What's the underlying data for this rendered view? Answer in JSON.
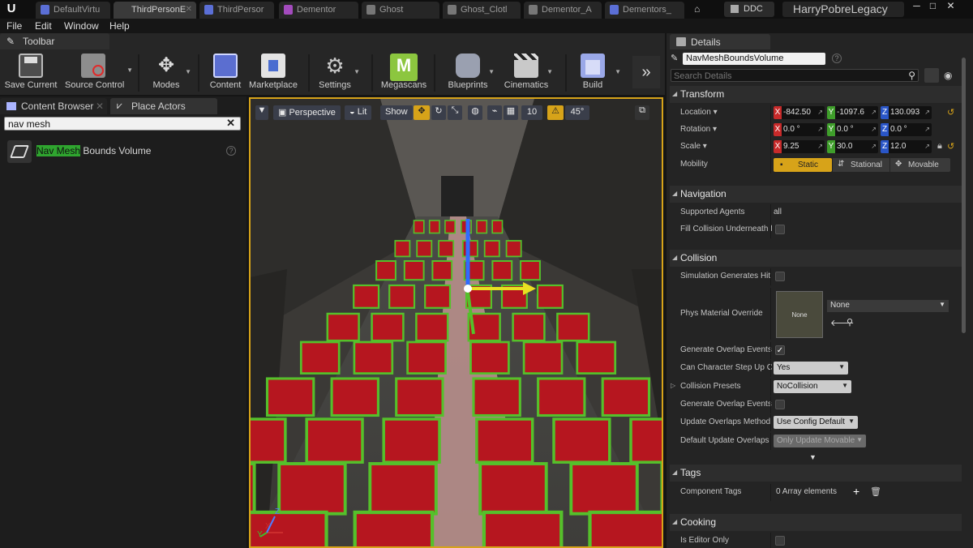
{
  "title_bar": {
    "tabs": [
      {
        "label": "DefaultVirtu",
        "color": "#5b6fd6"
      },
      {
        "label": "ThirdPersonE",
        "color": "#5b6fd6"
      },
      {
        "label": "ThirdPersor",
        "color": "#5b6fd6"
      },
      {
        "label": "Dementor",
        "color": "#a34bbd"
      },
      {
        "label": "Ghost",
        "color": "#9a9a9a"
      },
      {
        "label": "Ghost_Clotl",
        "color": "#9a9a9a"
      },
      {
        "label": "Dementor_A",
        "color": "#9a9a9a"
      },
      {
        "label": "Dementors_",
        "color": "#5b6fd6"
      }
    ],
    "ddc_label": "DDC",
    "project_name": "HarryPobreLegacy",
    "window_buttons": [
      "─",
      "□",
      "✕"
    ]
  },
  "menu": [
    "File",
    "Edit",
    "Window",
    "Help"
  ],
  "toolbar": {
    "tab_label": "Toolbar",
    "buttons": [
      {
        "label": "Save Current",
        "icon": "save-icon"
      },
      {
        "label": "Source Control",
        "icon": "source-control-icon"
      },
      {
        "label": "Modes",
        "icon": "modes-icon"
      },
      {
        "label": "Content",
        "icon": "content-icon"
      },
      {
        "label": "Marketplace",
        "icon": "marketplace-icon"
      },
      {
        "label": "Settings",
        "icon": "settings-icon"
      },
      {
        "label": "Megascans",
        "icon": "megascans-icon",
        "glyph": "M"
      },
      {
        "label": "Blueprints",
        "icon": "blueprints-icon"
      },
      {
        "label": "Cinematics",
        "icon": "cinematics-icon"
      },
      {
        "label": "Build",
        "icon": "build-icon"
      }
    ],
    "more": "»"
  },
  "left_panel": {
    "tabs": [
      "Content Browser",
      "Place Actors"
    ],
    "search_value": "nav mesh",
    "result": {
      "highlight": "Nav Mesh",
      "rest": " Bounds Volume"
    }
  },
  "viewport": {
    "buttons": [
      "Perspective",
      "Lit",
      "Show"
    ],
    "grid_value": "10",
    "angle_value": "45°",
    "axis": {
      "x": "X",
      "y": "Y",
      "z": "Z"
    }
  },
  "details": {
    "tab_label": "Details",
    "actor_name": "NavMeshBoundsVolume",
    "search_placeholder": "Search Details",
    "sections": {
      "transform": "Transform",
      "navigation": "Navigation",
      "collision": "Collision",
      "tags": "Tags",
      "cooking": "Cooking"
    },
    "location": {
      "label": "Location",
      "x": "-842.50",
      "y": "-1097.6",
      "z": "130.093"
    },
    "rotation": {
      "label": "Rotation",
      "x": "0.0 °",
      "y": "0.0 °",
      "z": "0.0 °"
    },
    "scale": {
      "label": "Scale",
      "x": "9.25",
      "y": "30.0",
      "z": "12.0"
    },
    "mobility": {
      "label": "Mobility",
      "options": [
        "Static",
        "Stational",
        "Movable"
      ],
      "selected": "Static"
    },
    "supported_agents": {
      "label": "Supported Agents",
      "value": "all"
    },
    "fill_collision": {
      "label": "Fill Collision Underneath f"
    },
    "sim_hit": {
      "label": "Simulation Generates Hit"
    },
    "phys_material": {
      "label": "Phys Material Override",
      "thumb": "None",
      "value": "None"
    },
    "gen_overlap": {
      "label": "Generate Overlap Events"
    },
    "char_step": {
      "label": "Can Character Step Up Or",
      "value": "Yes"
    },
    "collision_presets": {
      "label": "Collision Presets",
      "value": "NoCollision"
    },
    "gen_overlap2": {
      "label": "Generate Overlap Events"
    },
    "update_overlaps": {
      "label": "Update Overlaps Method",
      "value": "Use Config Default"
    },
    "default_overlaps": {
      "label": "Default Update Overlaps",
      "value": "Only Update Movable"
    },
    "component_tags": {
      "label": "Component Tags",
      "value": "0 Array elements"
    },
    "editor_only": {
      "label": "Is Editor Only"
    }
  },
  "colors": {
    "accent": "#d7a319",
    "x_axis": "#c72a2a",
    "y_axis": "#3f9e2b",
    "z_axis": "#2a56c8",
    "navmesh_green": "#55c02b",
    "pew_red": "#b6161f"
  }
}
